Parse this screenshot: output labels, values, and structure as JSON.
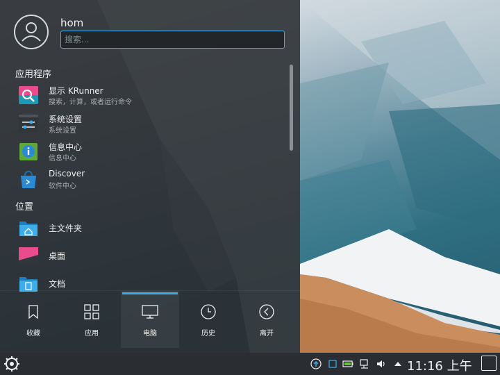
{
  "user": {
    "name": "hom"
  },
  "search": {
    "placeholder": "搜索..."
  },
  "sections": {
    "applications": "应用程序",
    "places": "位置"
  },
  "applications": [
    {
      "name": "显示 KRunner",
      "description": "搜索，计算，或者运行命令",
      "icon": "krunner-icon"
    },
    {
      "name": "系统设置",
      "description": "系统设置",
      "icon": "system-settings-icon"
    },
    {
      "name": "信息中心",
      "description": "信息中心",
      "icon": "info-center-icon"
    },
    {
      "name": "Discover",
      "description": "软件中心",
      "icon": "discover-icon"
    }
  ],
  "places": [
    {
      "name": "主文件夹",
      "icon": "home-folder-icon"
    },
    {
      "name": "桌面",
      "icon": "desktop-folder-icon"
    },
    {
      "name": "文档",
      "icon": "documents-folder-icon"
    }
  ],
  "tabs": [
    {
      "label": "收藏",
      "icon": "bookmark-icon",
      "active": false
    },
    {
      "label": "应用",
      "icon": "grid-icon",
      "active": false
    },
    {
      "label": "电脑",
      "icon": "monitor-icon",
      "active": true
    },
    {
      "label": "历史",
      "icon": "clock-icon",
      "active": false
    },
    {
      "label": "离开",
      "icon": "leave-icon",
      "active": false
    }
  ],
  "panel": {
    "clock": "11:16 上午"
  },
  "colors": {
    "accent": "#3daee9",
    "panel": "#2a2e32",
    "text": "#eff0f1"
  }
}
